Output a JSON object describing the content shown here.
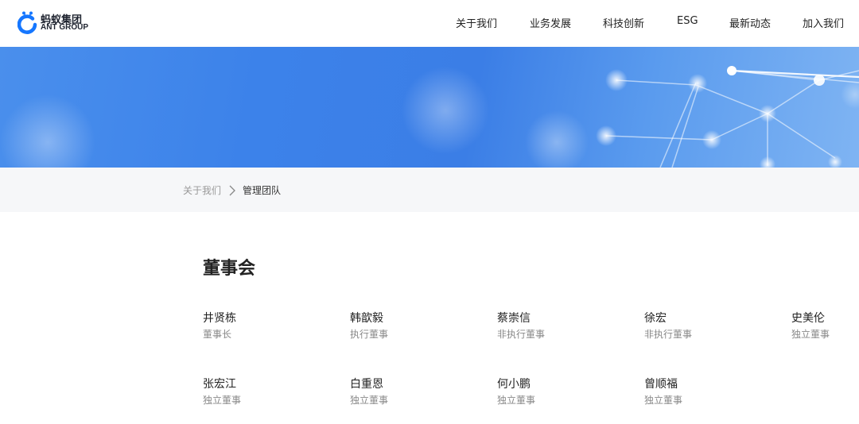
{
  "header": {
    "logo_cn": "蚂蚁集团",
    "logo_en": "ANT GROUP",
    "nav": [
      {
        "label": "关于我们"
      },
      {
        "label": "业务发展"
      },
      {
        "label": "科技创新"
      },
      {
        "label": "ESG"
      },
      {
        "label": "最新动态"
      },
      {
        "label": "加入我们"
      }
    ]
  },
  "colors": {
    "brand": "#1677ff",
    "banner_blue": "#3c82ea"
  },
  "breadcrumb": {
    "parent": "关于我们",
    "current": "管理团队"
  },
  "board": {
    "title": "董事会",
    "members": [
      {
        "name": "井贤栋",
        "role": "董事长"
      },
      {
        "name": "韩歆毅",
        "role": "执行董事"
      },
      {
        "name": "蔡崇信",
        "role": "非执行董事"
      },
      {
        "name": "徐宏",
        "role": "非执行董事"
      },
      {
        "name": "史美伦",
        "role": "独立董事"
      },
      {
        "name": "张宏江",
        "role": "独立董事"
      },
      {
        "name": "白重恩",
        "role": "独立董事"
      },
      {
        "name": "何小鹏",
        "role": "独立董事"
      },
      {
        "name": "曾顺福",
        "role": "独立董事"
      }
    ]
  }
}
